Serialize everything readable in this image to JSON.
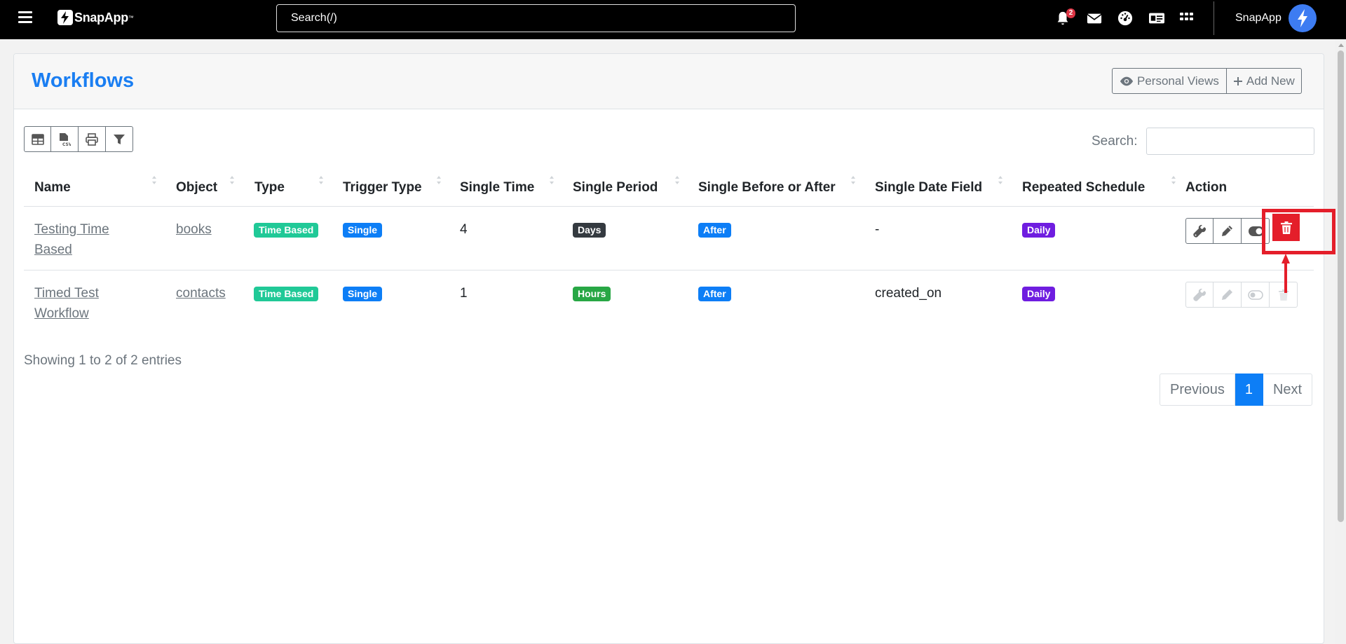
{
  "navbar": {
    "brand": "SnapApp",
    "brand_tm": "™",
    "search_placeholder": "Search(/)",
    "notification_count": "2",
    "user_name": "SnapApp",
    "icons": [
      "menu-icon",
      "bell-icon",
      "envelope-icon",
      "dashboard-icon",
      "id-card-icon",
      "apps-grid-icon",
      "bolt-icon"
    ]
  },
  "page": {
    "title": "Workflows",
    "personal_views_label": "Personal Views",
    "add_new_label": "Add New"
  },
  "toolbar": {
    "icons": [
      "table-icon",
      "csv-icon",
      "print-icon",
      "filter-icon"
    ],
    "search_label": "Search:",
    "search_value": ""
  },
  "table": {
    "columns": [
      "Name",
      "Object",
      "Type",
      "Trigger Type",
      "Single Time",
      "Single Period",
      "Single Before or After",
      "Single Date Field",
      "Repeated Schedule",
      "Action"
    ],
    "rows": [
      {
        "name_line1": "Testing Time",
        "name_line2": "Based",
        "object": "books",
        "type": "Time Based",
        "trigger_type": "Single",
        "single_time": "4",
        "single_period": "Days",
        "before_after": "After",
        "date_field": "-",
        "schedule": "Daily"
      },
      {
        "name_line1": "Timed Test",
        "name_line2": "Workflow",
        "object": "contacts",
        "type": "Time Based",
        "trigger_type": "Single",
        "single_time": "1",
        "single_period": "Hours",
        "before_after": "After",
        "date_field": "created_on",
        "schedule": "Daily"
      }
    ]
  },
  "footer": {
    "info": "Showing 1 to 2 of 2 entries",
    "prev": "Previous",
    "page": "1",
    "next": "Next"
  },
  "colors": {
    "brand_blue": "#1a7ef2",
    "time_based": "#20c997",
    "single": "#0d7ef6",
    "days": "#343a40",
    "hours": "#28a745",
    "after": "#0d7ef6",
    "daily": "#6f1de0",
    "highlight": "#e41e2a"
  }
}
